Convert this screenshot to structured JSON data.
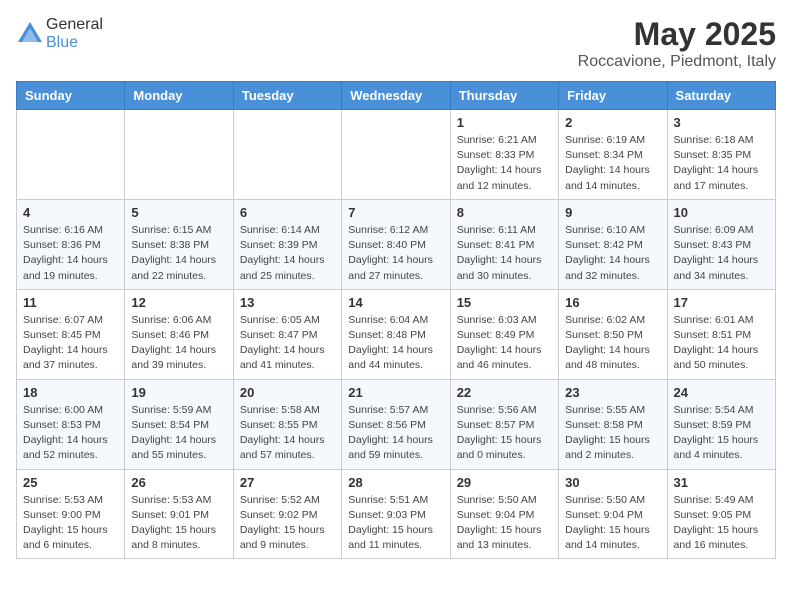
{
  "header": {
    "logo_general": "General",
    "logo_blue": "Blue",
    "month_title": "May 2025",
    "location": "Roccavione, Piedmont, Italy"
  },
  "days_of_week": [
    "Sunday",
    "Monday",
    "Tuesday",
    "Wednesday",
    "Thursday",
    "Friday",
    "Saturday"
  ],
  "weeks": [
    [
      {
        "day": "",
        "info": ""
      },
      {
        "day": "",
        "info": ""
      },
      {
        "day": "",
        "info": ""
      },
      {
        "day": "",
        "info": ""
      },
      {
        "day": "1",
        "info": "Sunrise: 6:21 AM\nSunset: 8:33 PM\nDaylight: 14 hours\nand 12 minutes."
      },
      {
        "day": "2",
        "info": "Sunrise: 6:19 AM\nSunset: 8:34 PM\nDaylight: 14 hours\nand 14 minutes."
      },
      {
        "day": "3",
        "info": "Sunrise: 6:18 AM\nSunset: 8:35 PM\nDaylight: 14 hours\nand 17 minutes."
      }
    ],
    [
      {
        "day": "4",
        "info": "Sunrise: 6:16 AM\nSunset: 8:36 PM\nDaylight: 14 hours\nand 19 minutes."
      },
      {
        "day": "5",
        "info": "Sunrise: 6:15 AM\nSunset: 8:38 PM\nDaylight: 14 hours\nand 22 minutes."
      },
      {
        "day": "6",
        "info": "Sunrise: 6:14 AM\nSunset: 8:39 PM\nDaylight: 14 hours\nand 25 minutes."
      },
      {
        "day": "7",
        "info": "Sunrise: 6:12 AM\nSunset: 8:40 PM\nDaylight: 14 hours\nand 27 minutes."
      },
      {
        "day": "8",
        "info": "Sunrise: 6:11 AM\nSunset: 8:41 PM\nDaylight: 14 hours\nand 30 minutes."
      },
      {
        "day": "9",
        "info": "Sunrise: 6:10 AM\nSunset: 8:42 PM\nDaylight: 14 hours\nand 32 minutes."
      },
      {
        "day": "10",
        "info": "Sunrise: 6:09 AM\nSunset: 8:43 PM\nDaylight: 14 hours\nand 34 minutes."
      }
    ],
    [
      {
        "day": "11",
        "info": "Sunrise: 6:07 AM\nSunset: 8:45 PM\nDaylight: 14 hours\nand 37 minutes."
      },
      {
        "day": "12",
        "info": "Sunrise: 6:06 AM\nSunset: 8:46 PM\nDaylight: 14 hours\nand 39 minutes."
      },
      {
        "day": "13",
        "info": "Sunrise: 6:05 AM\nSunset: 8:47 PM\nDaylight: 14 hours\nand 41 minutes."
      },
      {
        "day": "14",
        "info": "Sunrise: 6:04 AM\nSunset: 8:48 PM\nDaylight: 14 hours\nand 44 minutes."
      },
      {
        "day": "15",
        "info": "Sunrise: 6:03 AM\nSunset: 8:49 PM\nDaylight: 14 hours\nand 46 minutes."
      },
      {
        "day": "16",
        "info": "Sunrise: 6:02 AM\nSunset: 8:50 PM\nDaylight: 14 hours\nand 48 minutes."
      },
      {
        "day": "17",
        "info": "Sunrise: 6:01 AM\nSunset: 8:51 PM\nDaylight: 14 hours\nand 50 minutes."
      }
    ],
    [
      {
        "day": "18",
        "info": "Sunrise: 6:00 AM\nSunset: 8:53 PM\nDaylight: 14 hours\nand 52 minutes."
      },
      {
        "day": "19",
        "info": "Sunrise: 5:59 AM\nSunset: 8:54 PM\nDaylight: 14 hours\nand 55 minutes."
      },
      {
        "day": "20",
        "info": "Sunrise: 5:58 AM\nSunset: 8:55 PM\nDaylight: 14 hours\nand 57 minutes."
      },
      {
        "day": "21",
        "info": "Sunrise: 5:57 AM\nSunset: 8:56 PM\nDaylight: 14 hours\nand 59 minutes."
      },
      {
        "day": "22",
        "info": "Sunrise: 5:56 AM\nSunset: 8:57 PM\nDaylight: 15 hours\nand 0 minutes."
      },
      {
        "day": "23",
        "info": "Sunrise: 5:55 AM\nSunset: 8:58 PM\nDaylight: 15 hours\nand 2 minutes."
      },
      {
        "day": "24",
        "info": "Sunrise: 5:54 AM\nSunset: 8:59 PM\nDaylight: 15 hours\nand 4 minutes."
      }
    ],
    [
      {
        "day": "25",
        "info": "Sunrise: 5:53 AM\nSunset: 9:00 PM\nDaylight: 15 hours\nand 6 minutes."
      },
      {
        "day": "26",
        "info": "Sunrise: 5:53 AM\nSunset: 9:01 PM\nDaylight: 15 hours\nand 8 minutes."
      },
      {
        "day": "27",
        "info": "Sunrise: 5:52 AM\nSunset: 9:02 PM\nDaylight: 15 hours\nand 9 minutes."
      },
      {
        "day": "28",
        "info": "Sunrise: 5:51 AM\nSunset: 9:03 PM\nDaylight: 15 hours\nand 11 minutes."
      },
      {
        "day": "29",
        "info": "Sunrise: 5:50 AM\nSunset: 9:04 PM\nDaylight: 15 hours\nand 13 minutes."
      },
      {
        "day": "30",
        "info": "Sunrise: 5:50 AM\nSunset: 9:04 PM\nDaylight: 15 hours\nand 14 minutes."
      },
      {
        "day": "31",
        "info": "Sunrise: 5:49 AM\nSunset: 9:05 PM\nDaylight: 15 hours\nand 16 minutes."
      }
    ]
  ]
}
